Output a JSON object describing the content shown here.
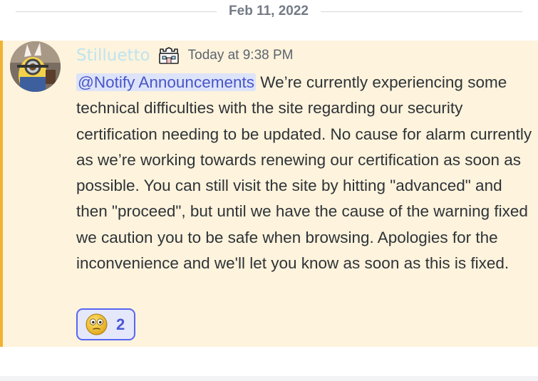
{
  "divider": {
    "date": "Feb 11, 2022"
  },
  "message": {
    "author": "Stilluetto",
    "role_icon": "bot-castle-icon",
    "timestamp": "Today at 9:38 PM",
    "mention": "@Notify Announcements",
    "body": " We’re currently experiencing some technical difficulties with the site regarding our security certification needing to be updated. No cause for alarm currently as we’re working towards renewing our certification as soon as possible. You can still visit the site by hitting \"advanced\" and then \"proceed\", but until we have the cause of the warning fixed we caution you to be safe when browsing. Apologies for the inconvenience and we'll let you know as soon as this is fixed.",
    "reaction": {
      "emoji": "flushed-face-emoji",
      "count": "2"
    }
  },
  "colors": {
    "highlight_bg": "#fef3dc",
    "accent": "#f0b232",
    "mention_text": "#4856c8",
    "reaction_border": "#5865f2"
  }
}
